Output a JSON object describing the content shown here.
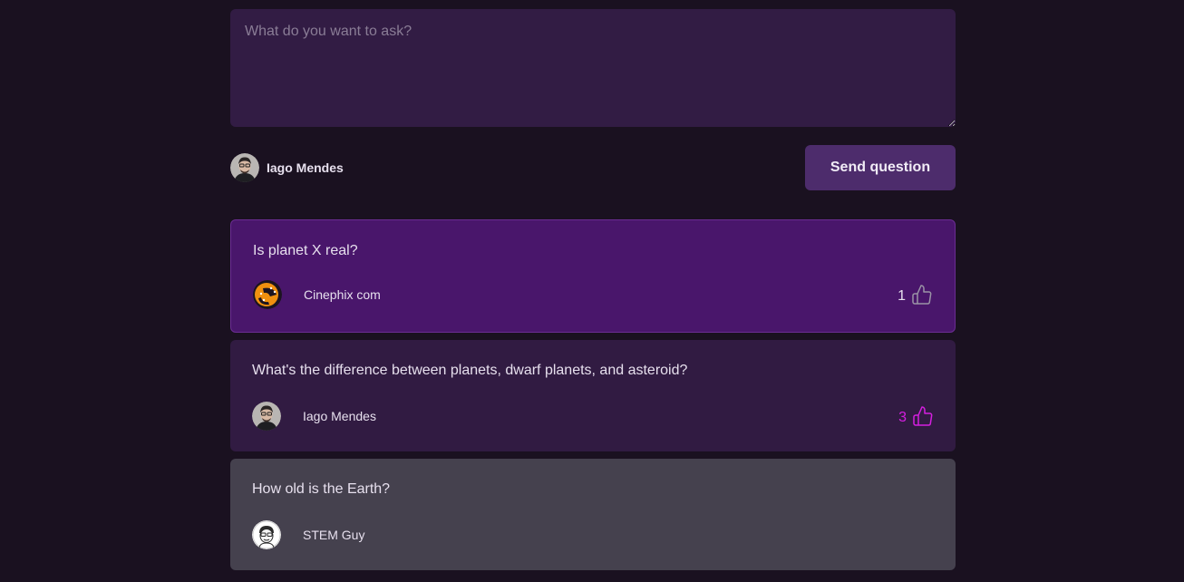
{
  "form": {
    "placeholder": "What do you want to ask?",
    "user_name": "Iago Mendes",
    "send_label": "Send question"
  },
  "questions": [
    {
      "content": "Is planet X real?",
      "author": "Cinephix com",
      "likes": "1",
      "state": "highlighted",
      "like_color": "#9a93a6"
    },
    {
      "content": "What's the difference between planets, dwarf planets, and asteroid?",
      "author": "Iago Mendes",
      "likes": "3",
      "state": "liked",
      "like_color": "#d51fe0"
    },
    {
      "content": "How old is the Earth?",
      "author": "STEM Guy",
      "state": "answered"
    }
  ],
  "colors": {
    "background": "#1a1120",
    "card": "#311b42",
    "highlight": "#49166b",
    "answered": "#45414e",
    "button": "#4d2c6c",
    "liked": "#d51fe0"
  }
}
